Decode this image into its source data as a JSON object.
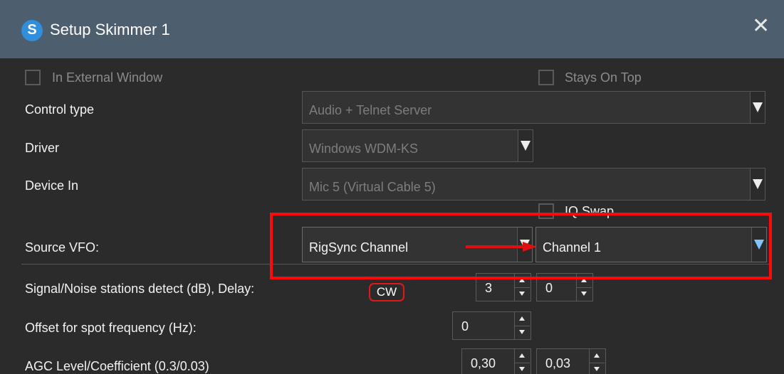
{
  "window": {
    "title": "Setup Skimmer 1",
    "icon": "skimmer-app-icon",
    "icon_glyph": "S",
    "close_glyph": "✕"
  },
  "options": {
    "in_external_window": {
      "label": "In External Window",
      "checked": false,
      "enabled": false
    },
    "stays_on_top": {
      "label": "Stays On Top",
      "checked": false,
      "enabled": false
    },
    "iq_swap": {
      "label": "IQ Swap",
      "checked": false,
      "enabled": false
    }
  },
  "fields": {
    "control_type": {
      "label": "Control type",
      "value": "Audio + Telnet Server"
    },
    "driver": {
      "label": "Driver",
      "value": "Windows WDM-KS"
    },
    "device_in": {
      "label": "Device In",
      "value": "Mic 5 (Virtual Cable 5)"
    },
    "source_vfo": {
      "label": "Source VFO:",
      "value": "RigSync Channel",
      "channel": "Channel 1"
    }
  },
  "params": {
    "signal_noise": {
      "label": "Signal/Noise stations detect (dB), Delay:",
      "mode_badge": "CW",
      "value": "3",
      "delay": "0"
    },
    "offset": {
      "label": "Offset for spot frequency (Hz):",
      "value": "0"
    },
    "agc": {
      "label": "AGC Level/Coefficient (0.3/0.03)",
      "level": "0,30",
      "coefficient": "0,03"
    }
  },
  "annotation": {
    "highlight_color": "#ff0a0a",
    "arrow_color": "#e01010"
  },
  "colors": {
    "titlebar": "#4d5e6e",
    "background": "#2b2b2b",
    "accent_blue": "#2f8fdc",
    "dropdown_active_arrow": "#7fc3ff"
  }
}
